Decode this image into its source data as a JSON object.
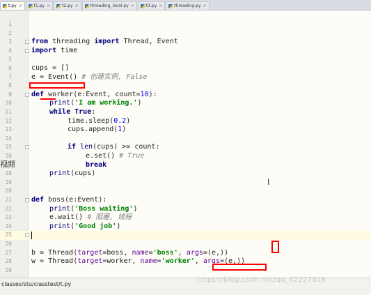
{
  "tabs": [
    {
      "label": "t.py",
      "active": true
    },
    {
      "label": "t1.py",
      "active": false
    },
    {
      "label": "t2.py",
      "active": false
    },
    {
      "label": "threading_local.py",
      "active": false
    },
    {
      "label": "t3.py",
      "active": false
    },
    {
      "label": "threading.py",
      "active": false
    }
  ],
  "editor": {
    "line_numbers": [
      "1",
      "2",
      "3",
      "4",
      "5",
      "6",
      "7",
      "8",
      "9",
      "10",
      "11",
      "12",
      "13",
      "14",
      "15",
      "16",
      "17",
      "18",
      "19",
      "20",
      "21",
      "22",
      "23",
      "24",
      "25",
      "26",
      "27",
      "28",
      "29"
    ],
    "code": {
      "l3": {
        "kw1": "from",
        "mod": " threading ",
        "kw2": "import",
        "rest": " Thread, Event"
      },
      "l4": {
        "kw": "import",
        "rest": " time"
      },
      "l6": {
        "text": "cups = []"
      },
      "l7": {
        "text": "e = Event() ",
        "comment": "# 创建实例, False"
      },
      "l9": {
        "kw": "def",
        "rest": " worker(e:Event, count=",
        "num": "10",
        "end": "):"
      },
      "l10": {
        "fn": "print",
        "open": "(",
        "str": "'I am working.'",
        "close": ")"
      },
      "l11": {
        "kw": "while",
        "sp": " ",
        "kw2": "True",
        "end": ":"
      },
      "l12": {
        "pre": "time.sleep(",
        "num": "0.2",
        "end": ")"
      },
      "l13": {
        "pre": "cups.append(",
        "num": "1",
        "end": ")"
      },
      "l15": {
        "kw": "if",
        "sp": " ",
        "fn": "len",
        "mid": "(cups) >= count:"
      },
      "l16": {
        "pre": "e.set() ",
        "comment": "# True"
      },
      "l17": {
        "kw": "break"
      },
      "l18": {
        "fn": "print",
        "rest": "(cups)"
      },
      "l21": {
        "kw": "def",
        "rest": " boss(e:Event):"
      },
      "l22": {
        "fn": "print",
        "open": "(",
        "str": "'Boss waiting'",
        "close": ")"
      },
      "l23": {
        "pre": "e.wait() ",
        "comment": "# 阻塞, 线程"
      },
      "l24": {
        "fn": "print",
        "open": "(",
        "str": "'Good job'",
        "close": ")"
      },
      "l27": {
        "pre": "b = Thread(",
        "k1": "target",
        "m1": "=boss, ",
        "k2": "name",
        "m2": "=",
        "str": "'boss'",
        "m3": ", ",
        "k3": "args",
        "end": "=(e,))"
      },
      "l28": {
        "pre": "w = Thread(",
        "k1": "target",
        "m1": "=worker, ",
        "k2": "name",
        "m2": "=",
        "str": "'worker'",
        "m3": ", ",
        "k3": "args",
        "end": "=(e,))"
      }
    }
  },
  "overlay": {
    "side_text": "视频",
    "cursor_glyph": "I",
    "watermark": "https://blog.csdn.net/qq_42227818"
  },
  "status": {
    "path": "classes/stu/classtest/t.py"
  },
  "colors": {
    "keyword": "#000080",
    "string": "#008000",
    "number": "#0000ff",
    "comment": "#808080",
    "kwarg": "#660099",
    "annotation": "#ff0000"
  }
}
